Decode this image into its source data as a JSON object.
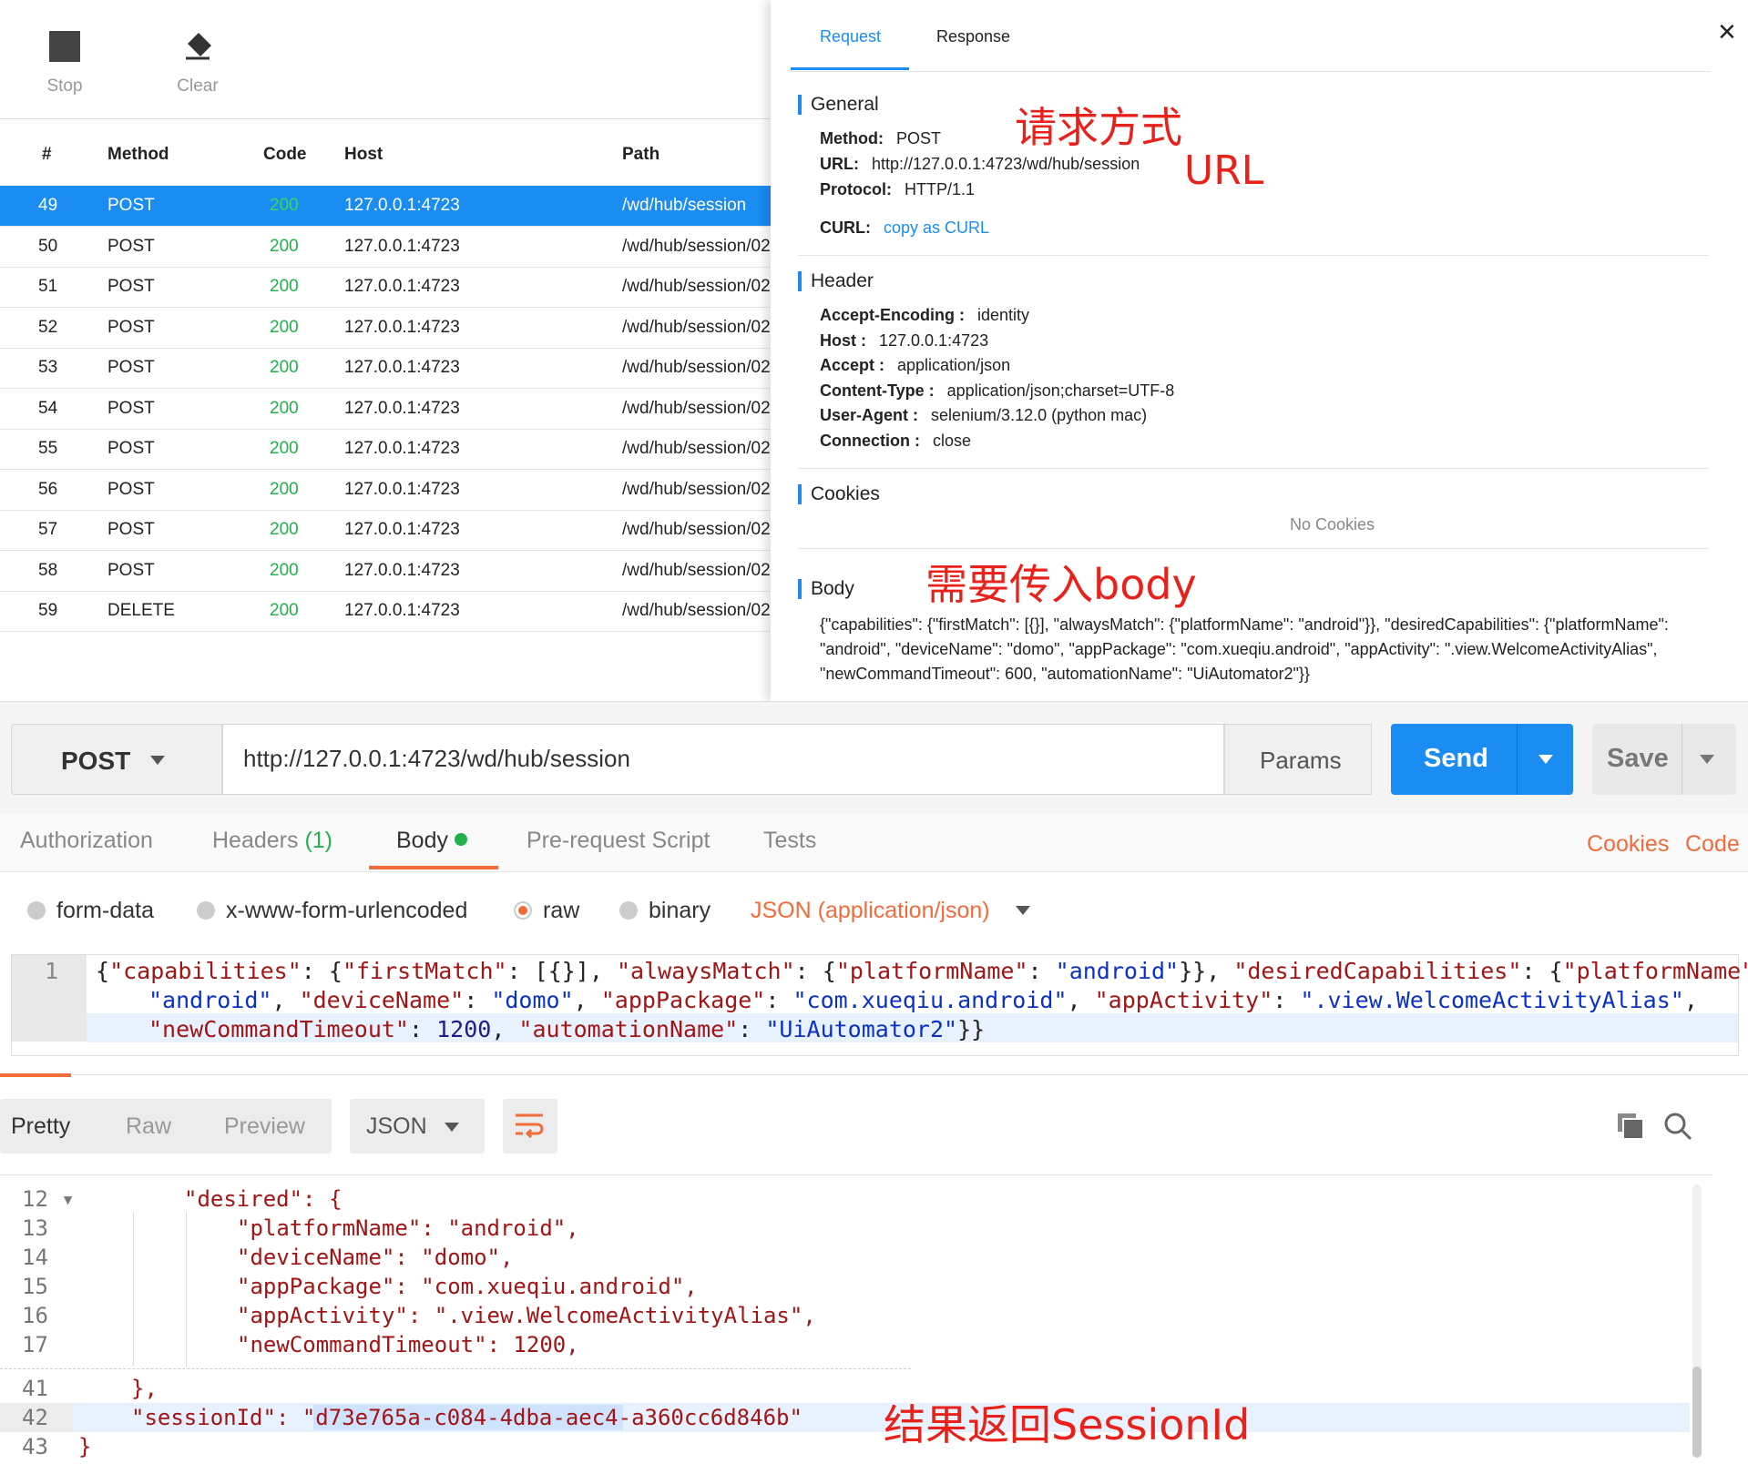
{
  "toolbar": {
    "stop_label": "Stop",
    "clear_label": "Clear"
  },
  "grid": {
    "columns": [
      "#",
      "Method",
      "Code",
      "Host",
      "Path"
    ],
    "rows": [
      {
        "num": "49",
        "method": "POST",
        "code": "200",
        "host": "127.0.0.1:4723",
        "path": "/wd/hub/session"
      },
      {
        "num": "50",
        "method": "POST",
        "code": "200",
        "host": "127.0.0.1:4723",
        "path": "/wd/hub/session/02"
      },
      {
        "num": "51",
        "method": "POST",
        "code": "200",
        "host": "127.0.0.1:4723",
        "path": "/wd/hub/session/02"
      },
      {
        "num": "52",
        "method": "POST",
        "code": "200",
        "host": "127.0.0.1:4723",
        "path": "/wd/hub/session/02"
      },
      {
        "num": "53",
        "method": "POST",
        "code": "200",
        "host": "127.0.0.1:4723",
        "path": "/wd/hub/session/02"
      },
      {
        "num": "54",
        "method": "POST",
        "code": "200",
        "host": "127.0.0.1:4723",
        "path": "/wd/hub/session/02"
      },
      {
        "num": "55",
        "method": "POST",
        "code": "200",
        "host": "127.0.0.1:4723",
        "path": "/wd/hub/session/02"
      },
      {
        "num": "56",
        "method": "POST",
        "code": "200",
        "host": "127.0.0.1:4723",
        "path": "/wd/hub/session/02"
      },
      {
        "num": "57",
        "method": "POST",
        "code": "200",
        "host": "127.0.0.1:4723",
        "path": "/wd/hub/session/02"
      },
      {
        "num": "58",
        "method": "POST",
        "code": "200",
        "host": "127.0.0.1:4723",
        "path": "/wd/hub/session/02"
      },
      {
        "num": "59",
        "method": "DELETE",
        "code": "200",
        "host": "127.0.0.1:4723",
        "path": "/wd/hub/session/02"
      }
    ]
  },
  "detail": {
    "tabs": [
      "Request",
      "Response"
    ],
    "close_glyph": "×",
    "general": {
      "title": "General",
      "method_label": "Method:",
      "method": "POST",
      "url_label": "URL:",
      "url": "http://127.0.0.1:4723/wd/hub/session",
      "protocol_label": "Protocol:",
      "protocol": "HTTP/1.1",
      "curl_label": "CURL:",
      "curl_link": "copy as CURL"
    },
    "header": {
      "title": "Header",
      "items": [
        {
          "k": "Accept-Encoding :",
          "v": "identity"
        },
        {
          "k": "Host :",
          "v": "127.0.0.1:4723"
        },
        {
          "k": "Accept :",
          "v": "application/json"
        },
        {
          "k": "Content-Type :",
          "v": "application/json;charset=UTF-8"
        },
        {
          "k": "User-Agent :",
          "v": "selenium/3.12.0 (python mac)"
        },
        {
          "k": "Connection :",
          "v": "close"
        }
      ]
    },
    "cookies": {
      "title": "Cookies",
      "empty": "No Cookies"
    },
    "body": {
      "title": "Body",
      "lines": [
        "{\"capabilities\": {\"firstMatch\": [{}], \"alwaysMatch\": {\"platformName\": \"android\"}}, \"desiredCapabilities\": {\"platformName\":",
        "\"android\", \"deviceName\": \"domo\", \"appPackage\": \"com.xueqiu.android\", \"appActivity\": \".view.WelcomeActivityAlias\",",
        "\"newCommandTimeout\": 600, \"automationName\": \"UiAutomator2\"}}"
      ]
    }
  },
  "annotations": {
    "method": "请求方式",
    "url": "URL",
    "body": "需要传入body",
    "session": "结果返回SessionId"
  },
  "request": {
    "method": "POST",
    "url": "http://127.0.0.1:4723/wd/hub/session",
    "params": "Params",
    "send": "Send",
    "save": "Save",
    "tabs": [
      "Authorization",
      "Headers",
      "(1)",
      "Body",
      "Pre-request Script",
      "Tests"
    ],
    "cookies": "Cookies",
    "code": "Code",
    "body_modes": [
      "form-data",
      "x-www-form-urlencoded",
      "raw",
      "binary"
    ],
    "content_type": "JSON (application/json)",
    "editor_line": "1"
  },
  "response": {
    "view_tabs": [
      "Pretty",
      "Raw",
      "Preview"
    ],
    "format": "JSON",
    "lines": [
      {
        "n": "12 ▾",
        "text": "\"desired\": {"
      },
      {
        "n": "13",
        "text": "\"platformName\": \"android\","
      },
      {
        "n": "14",
        "text": "\"deviceName\": \"domo\","
      },
      {
        "n": "15",
        "text": "\"appPackage\": \"com.xueqiu.android\","
      },
      {
        "n": "16",
        "text": "\"appActivity\": \".view.WelcomeActivityAlias\","
      },
      {
        "n": "17",
        "text": "\"newCommandTimeout\": 1200,"
      },
      {
        "n": "41",
        "text": "},"
      },
      {
        "n": "42",
        "text": "\"sessionId\": \"d73e765a-c084-4dba-aec4-a360cc6d846b\""
      },
      {
        "n": "43",
        "text": "}"
      }
    ]
  },
  "colors": {
    "accent": "#1a8cf2",
    "orange": "#f26b3a",
    "annotation": "#e8221b",
    "ok": "#22b14c"
  }
}
